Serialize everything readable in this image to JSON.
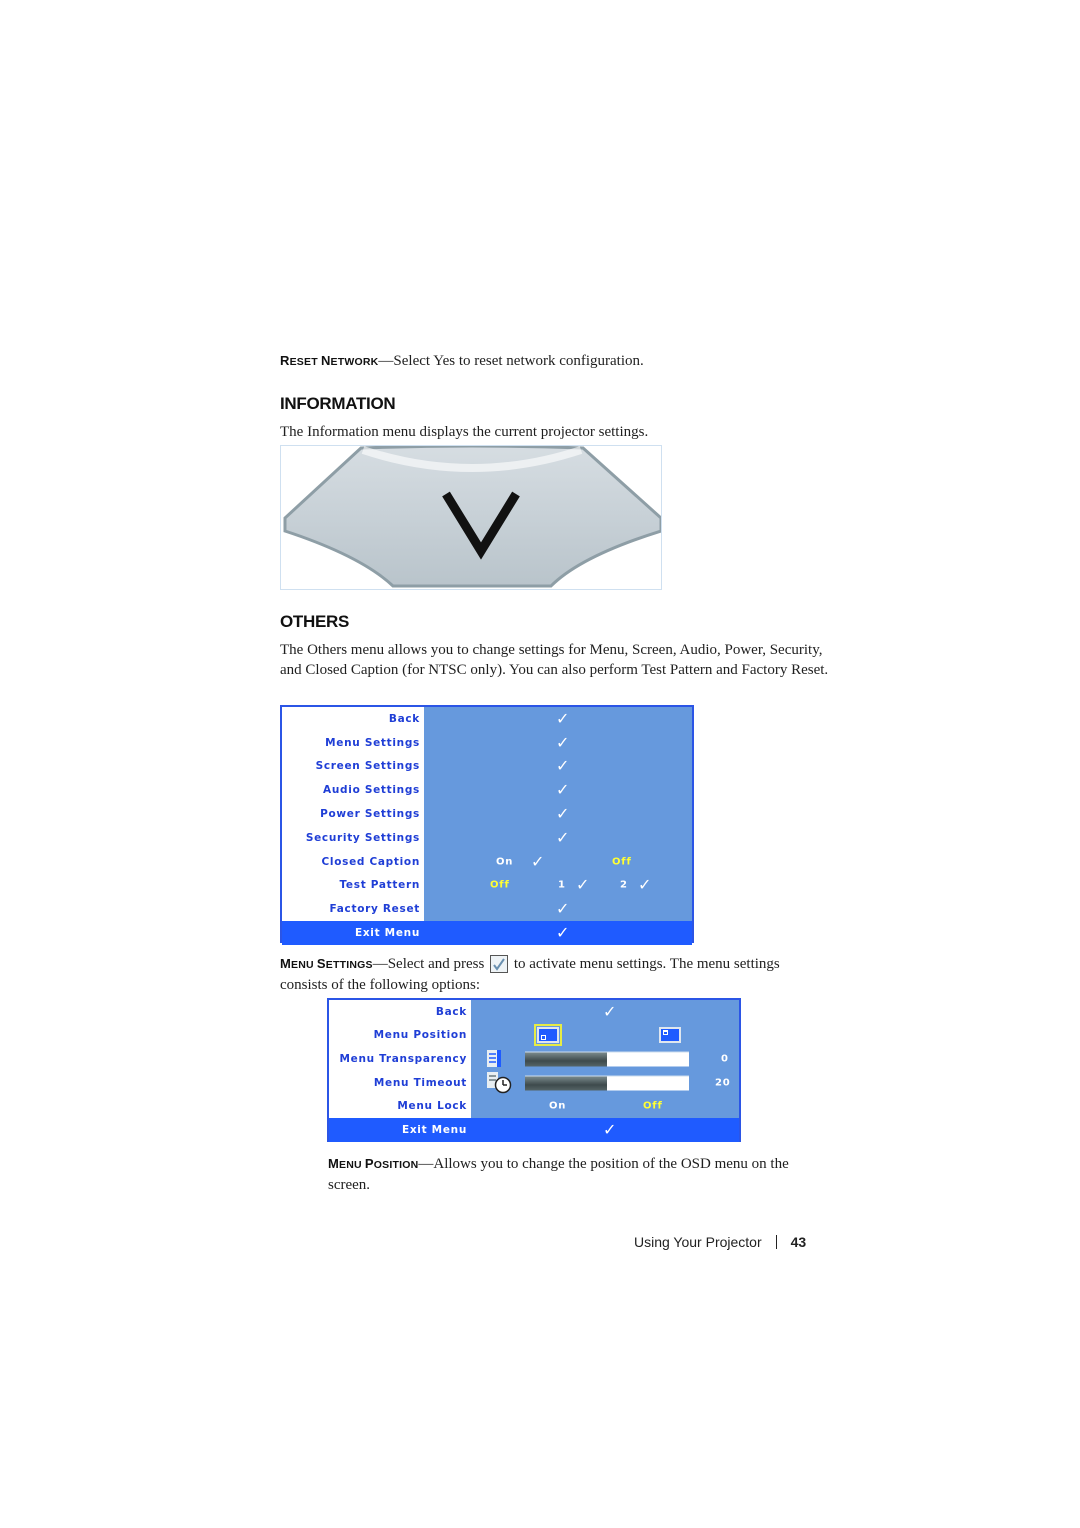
{
  "reset_network": {
    "term": "Reset Network",
    "text": "—Select Yes to reset network configuration."
  },
  "information": {
    "heading": "INFORMATION",
    "description": "The Information menu displays the current projector settings.",
    "image_icon": "down-arrow-nav-button-icon"
  },
  "others": {
    "heading": "OTHERS",
    "description": "The Others menu allows you to change settings for Menu, Screen, Audio, Power, Security, and Closed Caption (for NTSC only). You can also perform Test Pattern and Factory Reset.",
    "menu": {
      "rows": [
        {
          "label": "Back"
        },
        {
          "label": "Menu Settings"
        },
        {
          "label": "Screen Settings"
        },
        {
          "label": "Audio Settings"
        },
        {
          "label": "Power Settings"
        },
        {
          "label": "Security Settings"
        },
        {
          "label": "Closed Caption",
          "options": [
            "On",
            "Off"
          ],
          "selected": "Off"
        },
        {
          "label": "Test Pattern",
          "options": [
            "Off",
            "1",
            "2"
          ],
          "selected": "Off"
        },
        {
          "label": "Factory Reset"
        },
        {
          "label": "Exit Menu"
        }
      ],
      "check_glyph": "✓"
    }
  },
  "menu_settings": {
    "term": "Menu Settings",
    "text_before": "—Select and press ",
    "key_icon": "enter-check-key-icon",
    "text_after": " to activate menu settings. The menu settings consists of the following options:",
    "menu": {
      "rows": [
        {
          "label": "Back"
        },
        {
          "label": "Menu Position",
          "options": [
            "position-bottom-left",
            "position-top-left"
          ],
          "selected": "position-bottom-left"
        },
        {
          "label": "Menu Transparency",
          "value": "0",
          "slider_fraction": 0.5
        },
        {
          "label": "Menu Timeout",
          "value": "20",
          "slider_fraction": 0.5
        },
        {
          "label": "Menu Lock",
          "options": [
            "On",
            "Off"
          ],
          "selected": "Off"
        },
        {
          "label": "Exit Menu"
        }
      ],
      "check_glyph": "✓"
    }
  },
  "menu_position": {
    "term": "Menu Position",
    "text": "—Allows you to change the position of the OSD menu on the screen."
  },
  "footer": {
    "section": "Using Your Projector",
    "page_number": "43"
  },
  "colors": {
    "osd_background": "#6699dd",
    "osd_border": "#2b55e6",
    "osd_label": "#1f3ed6",
    "osd_exit_row": "#1f5bff",
    "osd_selected_option": "#ffff33"
  }
}
